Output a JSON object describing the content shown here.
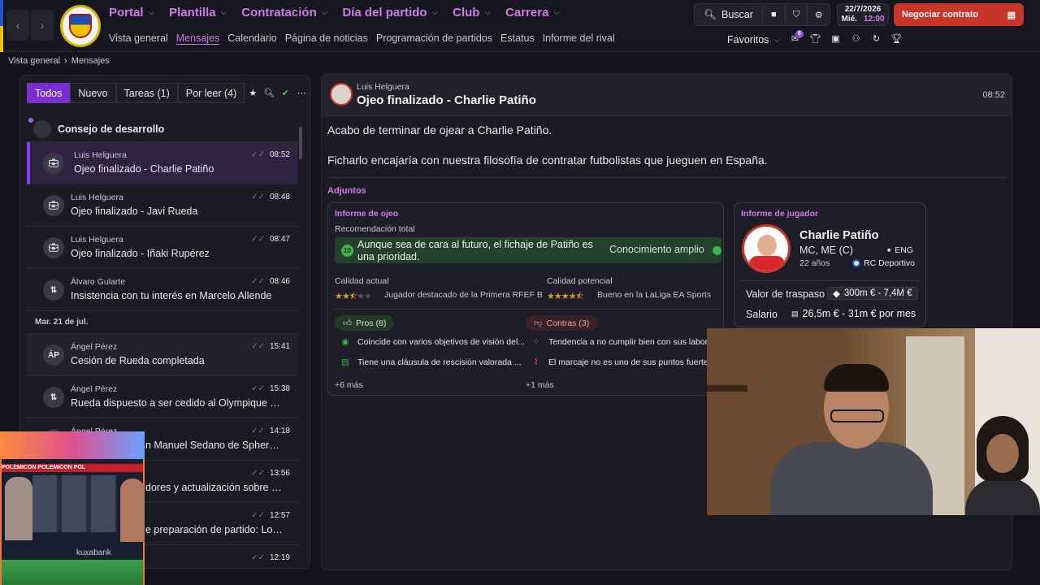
{
  "nav": {
    "menu": [
      "Portal",
      "Plantilla",
      "Contratación",
      "Día del partido",
      "Club",
      "Carrera"
    ],
    "submenu": [
      "Vista general",
      "Mensajes",
      "Calendario",
      "Página de noticias",
      "Programación de partidos",
      "Estatus",
      "Informe del rival"
    ],
    "active_submenu": "Mensajes",
    "search_label": "Buscar",
    "date": "22/7/2026",
    "weekday": "Mié.",
    "time": "12:00",
    "negociar_label": "Negociar contrato",
    "favoritos_label": "Favoritos",
    "notif_count": "6"
  },
  "breadcrumb": [
    "Vista general",
    "Mensajes"
  ],
  "inbox": {
    "filters": [
      "Todos",
      "Nuevo",
      "Tareas (1)",
      "Por leer (4)"
    ],
    "group_title": "Consejo de desarrollo",
    "messages": [
      {
        "sender": "Luis Helguera",
        "subject": "Ojeo finalizado - Charlie Patiño",
        "time": "08:52",
        "selected": true
      },
      {
        "sender": "Luis Helguera",
        "subject": "Ojeo finalizado - Javi Rueda",
        "time": "08:48"
      },
      {
        "sender": "Luis Helguera",
        "subject": "Ojeo finalizado - Iñaki Rupérez",
        "time": "08:47"
      },
      {
        "sender": "Álvaro Gularte",
        "subject": "Insistencia con tu interés en Marcelo Allende",
        "time": "08:46"
      }
    ],
    "date_separator": "Mar. 21 de jul.",
    "messages2": [
      {
        "sender": "Ángel Pérez",
        "subject": "Cesión de Rueda completada",
        "time": "15:41",
        "initials": "ÁP"
      },
      {
        "sender": "Ángel Pérez",
        "subject": "Rueda dispuesto a ser cedido al Olympique Lyo...",
        "time": "15:38"
      },
      {
        "sender": "Ángel Pérez",
        "subject": "n Manuel Sedano de Sphera Sp...",
        "time": "14:18"
      },
      {
        "sender": "",
        "subject": "dores y actualización sobre las...",
        "time": "13:56"
      },
      {
        "sender": "",
        "subject": "e preparación de partido: Loures",
        "time": "12:57"
      },
      {
        "sender": "",
        "subject": "",
        "time": "12:19"
      }
    ]
  },
  "message": {
    "from": "Luis Helguera",
    "title": "Ojeo finalizado - Charlie Patiño",
    "time": "08:52",
    "body1": "Acabo de terminar de ojear a Charlie Patiño.",
    "body2": "Ficharlo encajaría con nuestra filosofía de contratar futbolistas que jueguen en España.",
    "attachments_label": "Adjuntos"
  },
  "scout_report": {
    "title": "Informe de ojeo",
    "rec_label": "Recomendación total",
    "rec_score": "10",
    "rec_text": "Aunque sea de cara al futuro, el fichaje de Patiño es una prioridad.",
    "knowledge": "Conocimiento amplio",
    "current_label": "Calidad actual",
    "current_stars": 2.5,
    "current_text": "Jugador destacado de la Primera RFEF B",
    "potential_label": "Calidad potencial",
    "potential_stars": 4.5,
    "potential_text": "Bueno en la LaLiga EA Sports",
    "pros_label": "Pros (8)",
    "contras_label": "Contras (3)",
    "pros": [
      "Coincide con varios objetivos de visión del...",
      "Tiene una cláusula de rescisión valorada ..."
    ],
    "contras": [
      "Tendencia a no cumplir bien con sus labor...",
      "El marcaje no es uno de sus puntos fuertes"
    ],
    "pros_more": "+6 más",
    "contras_more": "+1 más"
  },
  "player_report": {
    "title": "Informe de jugador",
    "name": "Charlie Patiño",
    "positions": "MC, ME (C)",
    "nationality": "ENG",
    "age": "22 años",
    "club": "RC Deportivo",
    "transfer_label": "Valor de traspaso",
    "transfer_value": "300m € - 7,4M €",
    "salary_label": "Salario",
    "salary_value": "26,5m € - 31m € por mes"
  },
  "overlay": {
    "tv_ticker": "POLEMICON POLEMICON POL",
    "tv_caption": "kuxabank"
  },
  "colors": {
    "accent": "#d07be8",
    "selected_filter": "#7b2dcf",
    "negociar": "#c8362a",
    "positive": "#3fb44c"
  }
}
